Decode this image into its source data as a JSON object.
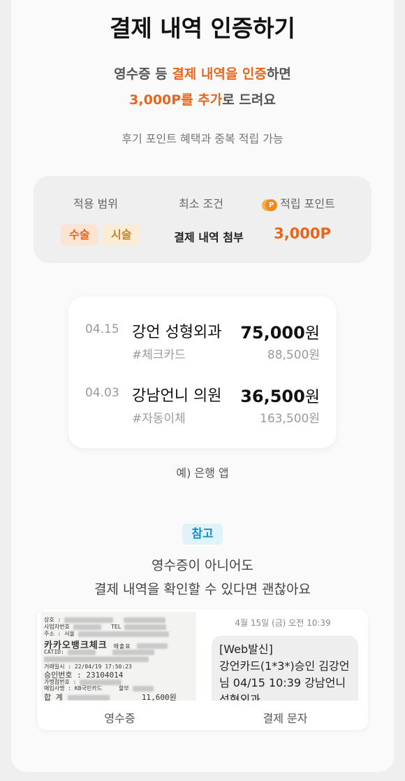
{
  "header": {
    "title": "결제 내역 인증하기",
    "sub1_pre": "영수증 등 ",
    "sub1_hl": "결제 내역을 인증",
    "sub1_post": "하면",
    "sub2_hl": "3,000P를 추가",
    "sub2_post": "로 드려요",
    "sub3": "후기 포인트 혜택과 중복 적립 가능"
  },
  "info": {
    "col1": "적용 범위",
    "col2": "최소 조건",
    "col3": "적립 포인트",
    "coin_glyph": "P",
    "tag1": "수술",
    "tag2": "시술",
    "condition": "결제 내역 첨부",
    "points": "3,000P"
  },
  "transactions": [
    {
      "date": "04.15",
      "name": "강언 성형외과",
      "amount": "75,000",
      "unit": "원",
      "method": "#체크카드",
      "original": "88,500원"
    },
    {
      "date": "04.03",
      "name": "강남언니 의원",
      "amount": "36,500",
      "unit": "원",
      "method": "#자동이체",
      "original": "163,500원"
    }
  ],
  "example_caption": "예) 은행 앱",
  "note": {
    "badge": "참고",
    "line1": "영수증이 아니어도",
    "line2": "결제 내역을 확인할 수 있다면 괜찮아요"
  },
  "proof": {
    "receipt": {
      "store": "카카오뱅크체크",
      "slip": "매출표",
      "approval_no": "23104014",
      "datetime": "22/04/19 17:50:23",
      "card": "KB국민카드",
      "total": "11,600원"
    },
    "sms_date": "4월 15일 (금) 오전 10:39",
    "sms_text": [
      "[Web발신]",
      "강언카드(1*3*)승인 김강언",
      "님 04/15 10:39 강남언니",
      "성형외과"
    ],
    "label_receipt": "영수증",
    "label_sms": "결제 문자"
  },
  "colors": {
    "accent": "#e8661c",
    "note_blue": "#1b8ec2",
    "background": "#efefef",
    "card": "#fafafa"
  }
}
